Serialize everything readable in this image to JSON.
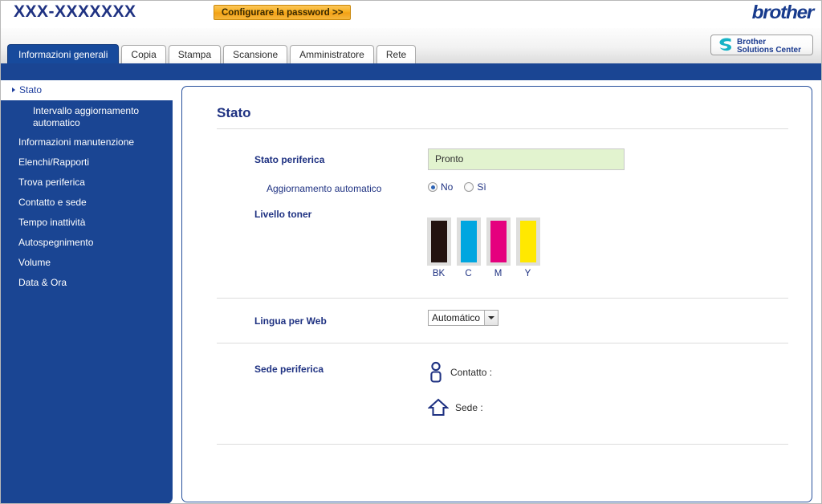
{
  "header": {
    "model_title": "XXX-XXXXXXX",
    "password_button": "Configurare la password >>",
    "brand_logo": "brother",
    "solutions_line1": "Brother",
    "solutions_line2": "Solutions Center"
  },
  "tabs": [
    {
      "label": "Informazioni generali",
      "active": true
    },
    {
      "label": "Copia",
      "active": false
    },
    {
      "label": "Stampa",
      "active": false
    },
    {
      "label": "Scansione",
      "active": false
    },
    {
      "label": "Amministratore",
      "active": false
    },
    {
      "label": "Rete",
      "active": false
    }
  ],
  "sidebar": {
    "items": [
      {
        "label": "Stato",
        "active": true,
        "sub": false
      },
      {
        "label": "Intervallo aggiornamento automatico",
        "active": false,
        "sub": true
      },
      {
        "label": "Informazioni manutenzione",
        "active": false,
        "sub": false
      },
      {
        "label": "Elenchi/Rapporti",
        "active": false,
        "sub": false
      },
      {
        "label": "Trova periferica",
        "active": false,
        "sub": false
      },
      {
        "label": "Contatto e sede",
        "active": false,
        "sub": false
      },
      {
        "label": "Tempo inattività",
        "active": false,
        "sub": false
      },
      {
        "label": "Autospegnimento",
        "active": false,
        "sub": false
      },
      {
        "label": "Volume",
        "active": false,
        "sub": false
      },
      {
        "label": "Data & Ora",
        "active": false,
        "sub": false
      }
    ]
  },
  "content": {
    "title": "Stato",
    "device_status_label": "Stato periferica",
    "device_status_value": "Pronto",
    "auto_refresh_label": "Aggiornamento automatico",
    "auto_refresh_options": [
      {
        "label": "No",
        "checked": true
      },
      {
        "label": "Sì",
        "checked": false
      }
    ],
    "toner_level_label": "Livello toner",
    "toner": [
      {
        "code": "BK",
        "color": "#231310",
        "level": 100
      },
      {
        "code": "C",
        "color": "#00a6e0",
        "level": 100
      },
      {
        "code": "M",
        "color": "#e5007e",
        "level": 100
      },
      {
        "code": "Y",
        "color": "#ffe800",
        "level": 100
      }
    ],
    "web_language_label": "Lingua per Web",
    "web_language_value": "Automático",
    "device_location_label": "Sede periferica",
    "contact_label": "Contatto :",
    "home_label": "Sede :"
  },
  "colors": {
    "brand_blue": "#1a4593",
    "accent_orange": "#f7ac1c",
    "status_green": "#e2f3cf",
    "text_blue": "#1f3282"
  }
}
